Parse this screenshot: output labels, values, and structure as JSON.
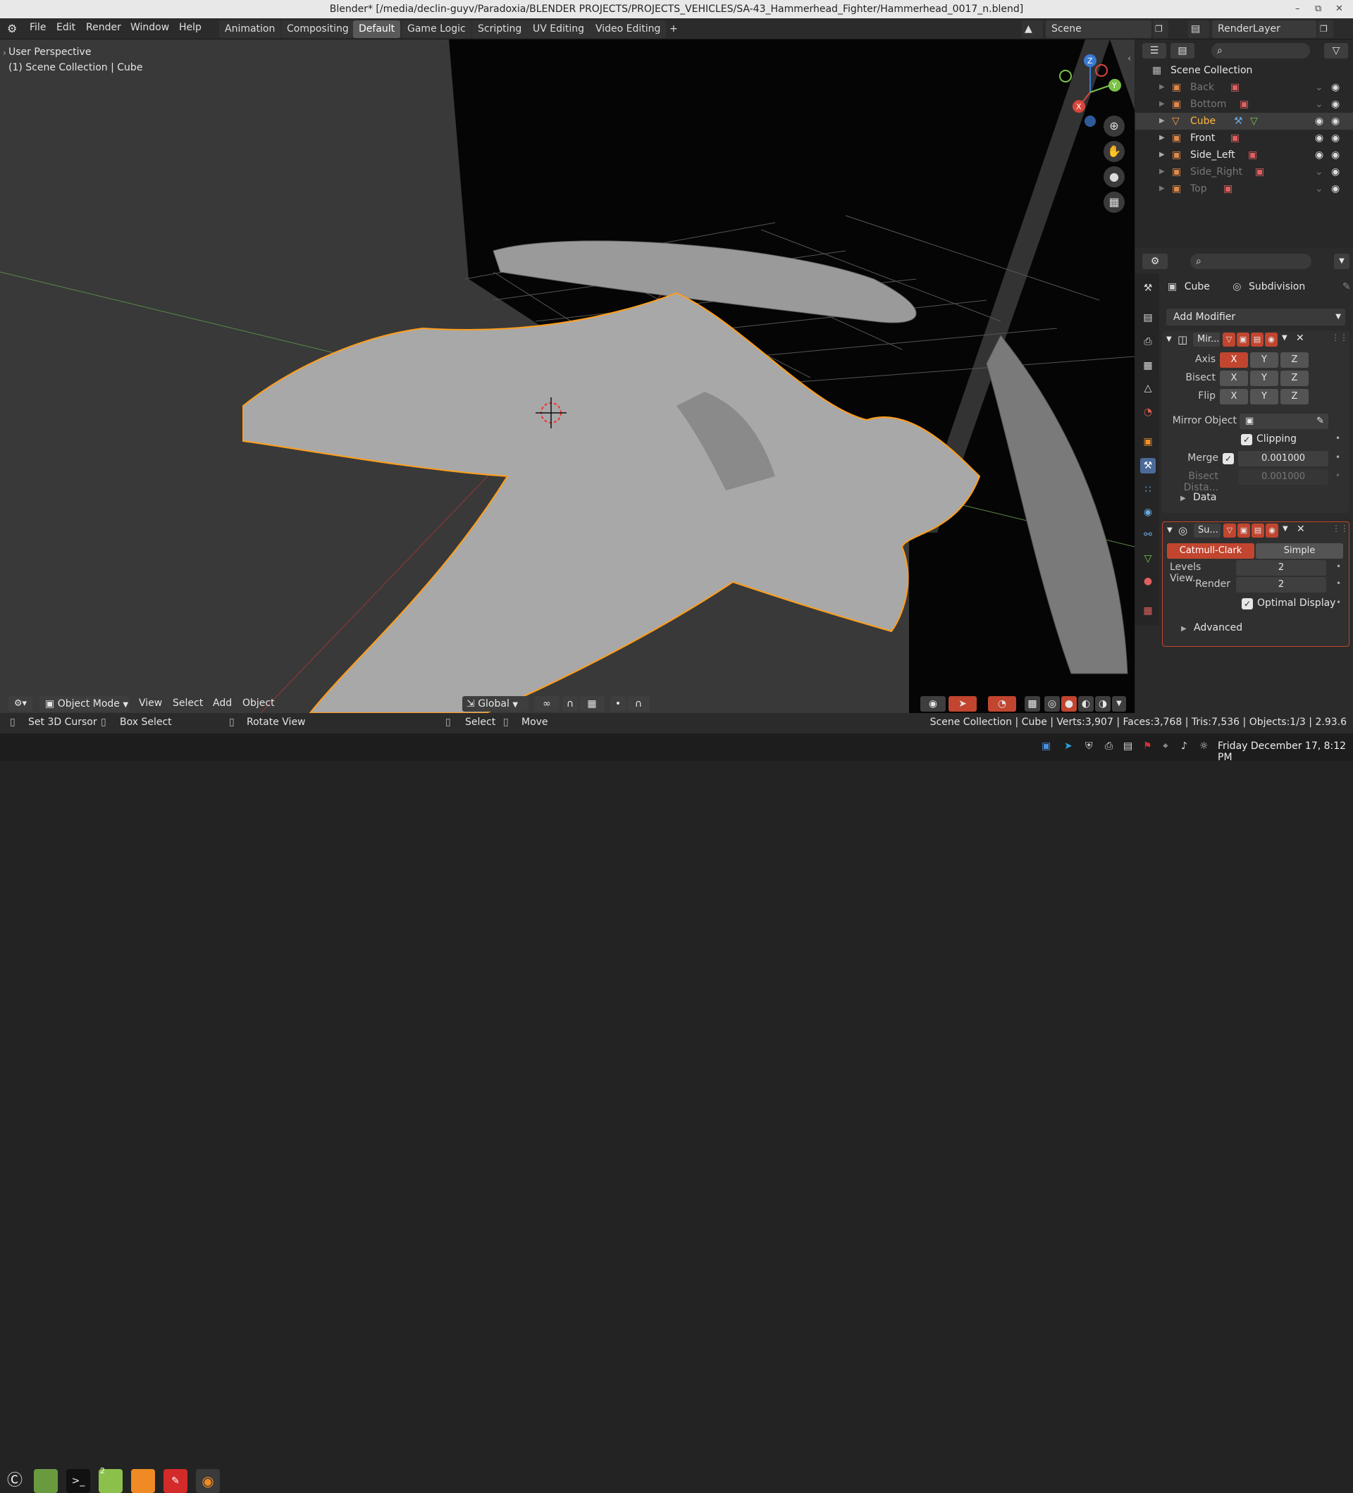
{
  "titlebar": {
    "title": "Blender* [/media/declin-guyv/Paradoxia/BLENDER PROJECTS/PROJECTS_VEHICLES/SA-43_Hammerhead_Fighter/Hammerhead_0017_n.blend]"
  },
  "menu": {
    "items": [
      "File",
      "Edit",
      "Render",
      "Window",
      "Help"
    ]
  },
  "workspaces": {
    "tabs": [
      "Animation",
      "Compositing",
      "Default",
      "Game Logic",
      "Scripting",
      "UV Editing",
      "Video Editing"
    ],
    "active": "Default",
    "add": "+"
  },
  "scene": {
    "name": "Scene",
    "render_layer": "RenderLayer"
  },
  "viewport": {
    "perspective": "User Perspective",
    "collection": "(1) Scene Collection | Cube",
    "mode": "Object Mode",
    "header_menus": [
      "View",
      "Select",
      "Add",
      "Object"
    ],
    "orientation": "Global",
    "axes": {
      "x": "X",
      "y": "Y",
      "z": "Z"
    }
  },
  "outliner": {
    "root": "Scene Collection",
    "items": [
      {
        "name": "Back",
        "visible": false
      },
      {
        "name": "Bottom",
        "visible": false
      },
      {
        "name": "Cube",
        "visible": true,
        "selected": true
      },
      {
        "name": "Front",
        "visible": true
      },
      {
        "name": "Side_Left",
        "visible": true
      },
      {
        "name": "Side_Right",
        "visible": false
      },
      {
        "name": "Top",
        "visible": false
      }
    ]
  },
  "properties": {
    "object": "Cube",
    "modifier_name": "Subdivision",
    "add_modifier": "Add Modifier",
    "mirror": {
      "name": "Mir...",
      "axis_label": "Axis",
      "bisect_label": "Bisect",
      "flip_label": "Flip",
      "axes": [
        "X",
        "Y",
        "Z"
      ],
      "mirror_object_label": "Mirror Object",
      "clipping_label": "Clipping",
      "merge_label": "Merge",
      "merge_value": "0.001000",
      "bisect_distance_label": "Bisect Dista...",
      "bisect_distance_value": "0.001000",
      "data_label": "Data"
    },
    "subdivision": {
      "name": "Su...",
      "catmull": "Catmull-Clark",
      "simple": "Simple",
      "levels_label": "Levels View...",
      "levels_value": "2",
      "render_label": "Render",
      "render_value": "2",
      "optimal_label": "Optimal Display",
      "advanced_label": "Advanced"
    }
  },
  "statusbar": {
    "set_cursor": "Set 3D Cursor",
    "box_select": "Box Select",
    "rotate": "Rotate View",
    "select": "Select",
    "move": "Move",
    "info": "Scene Collection | Cube | Verts:3,907 | Faces:3,768 | Tris:7,536 | Objects:1/3 | 2.93.6"
  },
  "taskbar": {
    "datetime": "Friday December 17,  8:12 PM",
    "badge": "2"
  },
  "colors": {
    "accent": "#c1452f",
    "selection": "#ff9e1a",
    "header": "#2b2b2b"
  }
}
